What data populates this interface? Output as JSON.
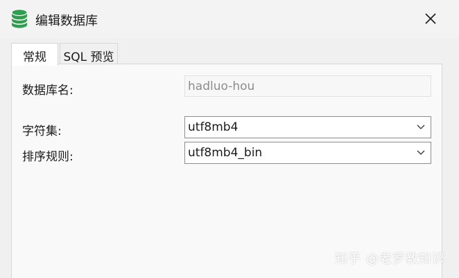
{
  "window": {
    "title": "编辑数据库",
    "icon": "database-icon",
    "close_icon": "close-icon"
  },
  "tabs": [
    {
      "label": "常规",
      "active": true
    },
    {
      "label": "SQL 预览",
      "active": false
    }
  ],
  "form": {
    "database_name": {
      "label": "数据库名:",
      "value": "hadluo-hou"
    },
    "charset": {
      "label": "字符集:",
      "value": "utf8mb4"
    },
    "collation": {
      "label": "排序规则:",
      "value": "utf8mb4_bin"
    }
  },
  "watermark": "知乎 @老罗教知识",
  "colors": {
    "icon_green": "#2e9e4f",
    "panel": "#f9f9f9",
    "border": "#8e8e8e"
  }
}
